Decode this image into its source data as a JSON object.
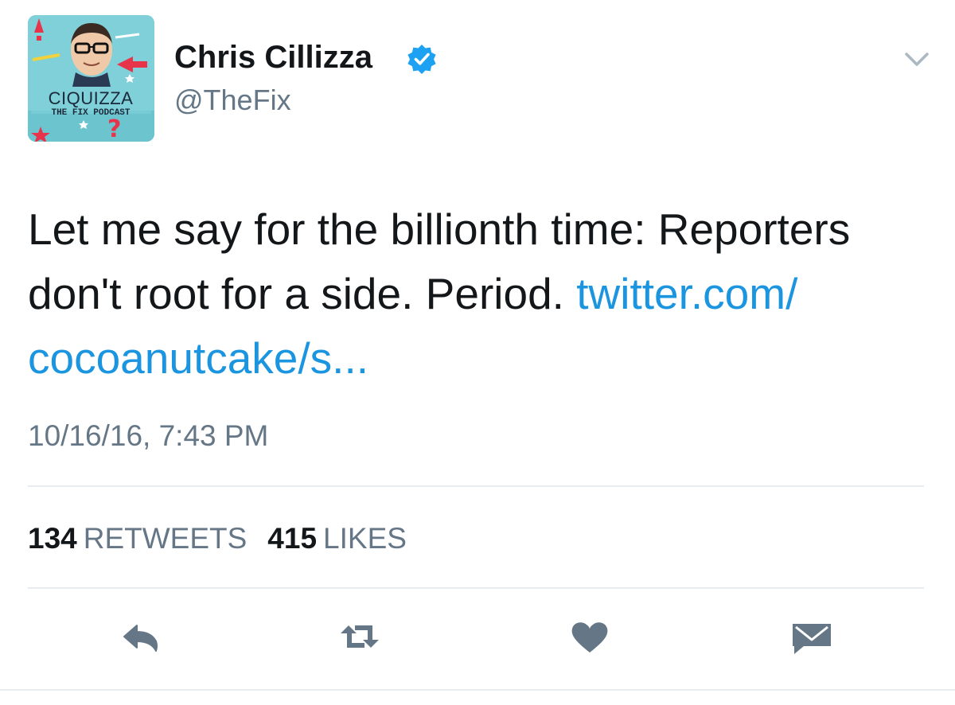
{
  "author": {
    "name": "Chris Cillizza",
    "handle": "@TheFix",
    "verified": true,
    "avatar_text": {
      "title": "CIQUIZZA",
      "subtitle": "THE FIX PODCAST"
    }
  },
  "tweet": {
    "text": "Let me say for the billionth time: Reporters don't root for a side. Period.",
    "link_line1": "twitter.com/",
    "link_line2": "cocoanutcake/s...",
    "timestamp": "10/16/16, 7:43 PM"
  },
  "stats": {
    "retweets_count": "134",
    "retweets_label": "RETWEETS",
    "likes_count": "415",
    "likes_label": "LIKES"
  },
  "icons": {
    "reply": "reply-icon",
    "retweet": "retweet-icon",
    "like": "heart-icon",
    "dm": "envelope-icon",
    "menu": "chevron-down-icon",
    "verified": "verified-badge-icon"
  },
  "colors": {
    "text": "#14171a",
    "secondary": "#657786",
    "link": "#1b95e0",
    "verified": "#1da1f2",
    "divider": "#e6ecf0",
    "action_icon": "#657786"
  }
}
